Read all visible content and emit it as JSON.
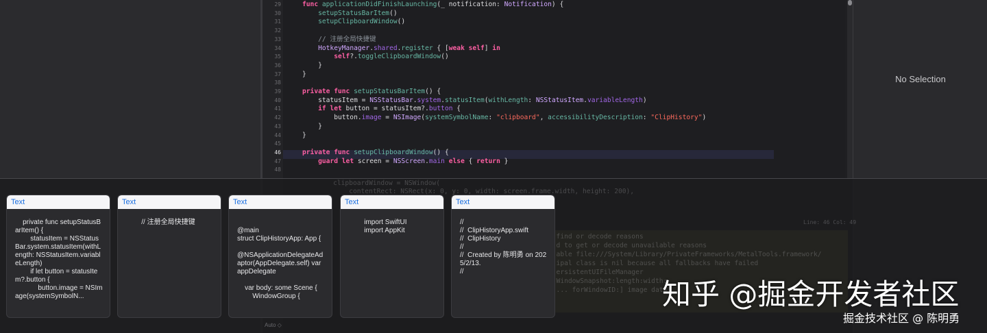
{
  "inspector": {
    "no_selection": "No Selection"
  },
  "editor": {
    "lines": [
      {
        "n": "29",
        "parts": [
          [
            "kw",
            "func "
          ],
          [
            "fn",
            "applicationDidFinishLaunching"
          ],
          [
            "",
            "(_ notification: "
          ],
          [
            "ty",
            "Notification"
          ],
          [
            "",
            ") {"
          ]
        ]
      },
      {
        "n": "30",
        "parts": [
          [
            "",
            "    "
          ],
          [
            "mt",
            "setupStatusBarItem"
          ],
          [
            "",
            "()"
          ]
        ]
      },
      {
        "n": "31",
        "parts": [
          [
            "",
            "    "
          ],
          [
            "mt",
            "setupClipboardWindow"
          ],
          [
            "",
            "()"
          ]
        ]
      },
      {
        "n": "32",
        "parts": [
          [
            "",
            ""
          ]
        ]
      },
      {
        "n": "33",
        "parts": [
          [
            "",
            "    "
          ],
          [
            "cm",
            "// 注册全局快捷键"
          ]
        ]
      },
      {
        "n": "34",
        "parts": [
          [
            "",
            "    "
          ],
          [
            "ty",
            "HotkeyManager"
          ],
          [
            "",
            "."
          ],
          [
            "pr",
            "shared"
          ],
          [
            "",
            "."
          ],
          [
            "mt",
            "register"
          ],
          [
            "",
            " { ["
          ],
          [
            "kw",
            "weak self"
          ],
          [
            "",
            "] "
          ],
          [
            "kw",
            "in"
          ]
        ]
      },
      {
        "n": "35",
        "parts": [
          [
            "",
            "        "
          ],
          [
            "kw",
            "self"
          ],
          [
            "",
            "?."
          ],
          [
            "mt",
            "toggleClipboardWindow"
          ],
          [
            "",
            "()"
          ]
        ]
      },
      {
        "n": "36",
        "parts": [
          [
            "",
            "    }"
          ]
        ]
      },
      {
        "n": "37",
        "parts": [
          [
            "",
            "}"
          ]
        ]
      },
      {
        "n": "38",
        "parts": [
          [
            "",
            ""
          ]
        ]
      },
      {
        "n": "39",
        "parts": [
          [
            "kw",
            "private func "
          ],
          [
            "fn",
            "setupStatusBarItem"
          ],
          [
            "",
            "() {"
          ]
        ]
      },
      {
        "n": "40",
        "parts": [
          [
            "",
            "    statusItem = "
          ],
          [
            "ty",
            "NSStatusBar"
          ],
          [
            "",
            "."
          ],
          [
            "pr",
            "system"
          ],
          [
            "",
            "."
          ],
          [
            "mt",
            "statusItem"
          ],
          [
            "",
            "("
          ],
          [
            "mt",
            "withLength"
          ],
          [
            "",
            ": "
          ],
          [
            "ty",
            "NSStatusItem"
          ],
          [
            "",
            "."
          ],
          [
            "pr",
            "variableLength"
          ],
          [
            "",
            ")"
          ]
        ]
      },
      {
        "n": "41",
        "parts": [
          [
            "",
            "    "
          ],
          [
            "kw",
            "if let "
          ],
          [
            "",
            "button = statusItem?."
          ],
          [
            "pr",
            "button"
          ],
          [
            "",
            " {"
          ]
        ]
      },
      {
        "n": "42",
        "parts": [
          [
            "",
            "        button."
          ],
          [
            "pr",
            "image"
          ],
          [
            "",
            " = "
          ],
          [
            "ty",
            "NSImage"
          ],
          [
            "",
            "("
          ],
          [
            "mt",
            "systemSymbolName"
          ],
          [
            "",
            ": "
          ],
          [
            "st",
            "\"clipboard\""
          ],
          [
            "",
            ", "
          ],
          [
            "mt",
            "accessibilityDescription"
          ],
          [
            "",
            ": "
          ],
          [
            "st",
            "\"ClipHistory\""
          ],
          [
            "",
            ")"
          ]
        ]
      },
      {
        "n": "43",
        "parts": [
          [
            "",
            "    }"
          ]
        ]
      },
      {
        "n": "44",
        "parts": [
          [
            "",
            "}"
          ]
        ]
      },
      {
        "n": "45",
        "parts": [
          [
            "",
            ""
          ]
        ]
      },
      {
        "n": "46",
        "parts": [
          [
            "kw",
            "private func "
          ],
          [
            "fn",
            "setupClipboardWindow"
          ],
          [
            "",
            "() {"
          ]
        ]
      },
      {
        "n": "47",
        "parts": [
          [
            "",
            "    "
          ],
          [
            "kw",
            "guard let "
          ],
          [
            "",
            "screen = "
          ],
          [
            "ty",
            "NSScreen"
          ],
          [
            "",
            "."
          ],
          [
            "pr",
            "main"
          ],
          [
            "kw",
            " else "
          ],
          [
            "",
            "{ "
          ],
          [
            "kw",
            "return"
          ],
          [
            "",
            " }"
          ]
        ]
      },
      {
        "n": "48",
        "parts": [
          [
            "",
            ""
          ]
        ]
      }
    ],
    "active_line": "46"
  },
  "ghost": {
    "line1": "    clipboardWindow = NSWindow(",
    "line2": "        contentRect: NSRect(x: 0, y: 0, width: screen.frame.width, height: 200),",
    "panel": [
      "  find or decode reasons",
      "  d to get or decode unavailable reasons",
      "  able file:///System/Library/PrivateFrameworks/MetalTools.framework/",
      "  ipal class is nil because all fallbacks have failed",
      "  ersistentUIFileManager",
      "  WindowSnapshot:length:width:",
      "  ... forWindowID:] image data"
    ],
    "line_col": "Line: 46  Col: 49",
    "status": "Auto ◇"
  },
  "cards": [
    {
      "header": "Text",
      "body": "    private func setupStatusBarItem() {\n        statusItem = NSStatusBar.system.statusItem(withLength: NSStatusItem.variableLength)\n        if let button = statusItem?.button {\n            button.image = NSImage(systemSymbolN..."
    },
    {
      "header": "Text",
      "body": "        // 注册全局快捷键"
    },
    {
      "header": "Text",
      "body": "\n@main\nstruct ClipHistoryApp: App {\n\n@NSApplicationDelegateAdaptor(AppDelegate.self) var appDelegate\n\n    var body: some Scene {\n        WindowGroup {"
    },
    {
      "header": "Text",
      "body": "        import SwiftUI\n        import AppKit"
    },
    {
      "header": "Text",
      "body": "//\n//  ClipHistoryApp.swift\n//  ClipHistory\n//\n//  Created by 陈明勇 on 2025/2/13.\n//"
    }
  ],
  "watermark": {
    "main": "知乎 @掘金开发者社区",
    "sub": "掘金技术社区 @ 陈明勇"
  }
}
